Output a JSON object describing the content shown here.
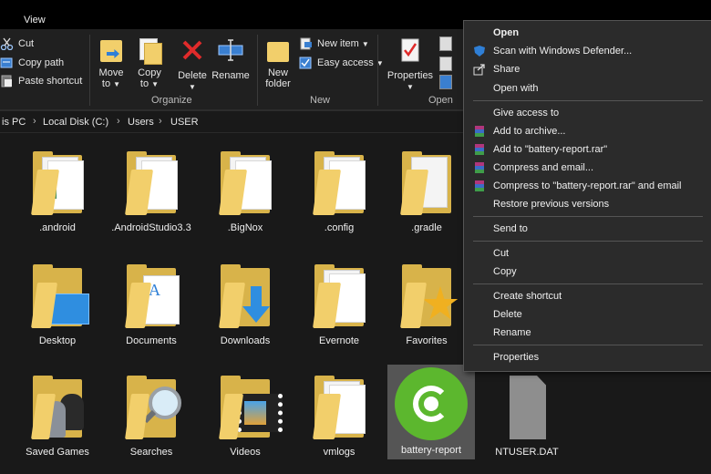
{
  "ribbon": {
    "tab_view": "View",
    "clipboard": {
      "cut": "Cut",
      "copy_path": "Copy path",
      "paste_shortcut": "Paste shortcut"
    },
    "organize": {
      "label": "Organize",
      "move_to": "Move",
      "move_to_2": "to",
      "copy_to": "Copy",
      "copy_to_2": "to",
      "delete": "Delete",
      "rename": "Rename"
    },
    "new": {
      "label": "New",
      "new_folder": "New",
      "new_folder_2": "folder",
      "new_item": "New item",
      "easy_access": "Easy access"
    },
    "open": {
      "label": "Open",
      "properties": "Properties"
    }
  },
  "address": {
    "crumbs": [
      "is PC",
      "Local Disk (C:)",
      "Users",
      "USER"
    ]
  },
  "files": [
    {
      "name": ".android"
    },
    {
      "name": ".AndroidStudio3.3"
    },
    {
      "name": ".BigNox"
    },
    {
      "name": ".config"
    },
    {
      "name": ".gradle"
    },
    {
      "name": "Desktop"
    },
    {
      "name": "Documents"
    },
    {
      "name": "Downloads"
    },
    {
      "name": "Evernote"
    },
    {
      "name": "Favorites"
    },
    {
      "name": "Saved Games"
    },
    {
      "name": "Searches"
    },
    {
      "name": "Videos"
    },
    {
      "name": "vmlogs"
    },
    {
      "name": "battery-report"
    },
    {
      "name": "NTUSER.DAT"
    }
  ],
  "context_menu": {
    "items": [
      "Open",
      "Scan with Windows Defender...",
      "Share",
      "Open with",
      "Give access to",
      "Add to archive...",
      "Add to \"battery-report.rar\"",
      "Compress and email...",
      "Compress to \"battery-report.rar\" and email",
      "Restore previous versions",
      "Send to",
      "Cut",
      "Copy",
      "Create shortcut",
      "Delete",
      "Rename",
      "Properties"
    ]
  },
  "colors": {
    "background": "#191919",
    "ribbon": "#202020",
    "menu": "#2b2b2b",
    "folder": "#f2cf6b",
    "delete_red": "#e02b2b",
    "accent_blue": "#2f7fd6"
  }
}
